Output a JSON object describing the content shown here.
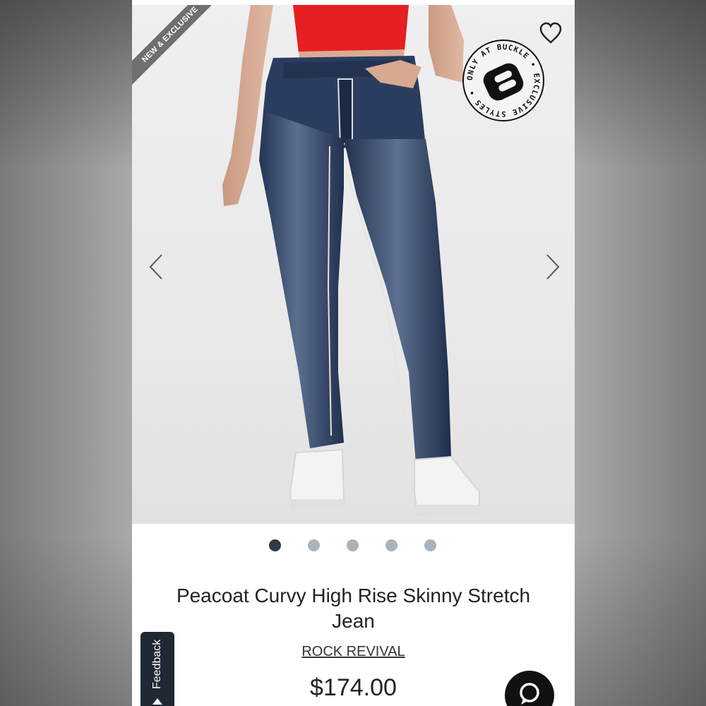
{
  "product": {
    "ribbon": "NEW & EXCLUSIVE",
    "badge_text": "ONLY AT BUCKLE • EXCLUSIVE STYLES •",
    "title": "Peacoat Curvy High Rise Skinny Stretch Jean",
    "brand": "ROCK REVIVAL",
    "price": "$174.00"
  },
  "carousel": {
    "total_images": 5,
    "active_index": 0
  },
  "feedback": {
    "label": "Feedback"
  },
  "icons": {
    "favorite": "heart-outline-icon",
    "prev": "chevron-left-icon",
    "next": "chevron-right-icon",
    "chat": "chat-bubble-icon"
  },
  "colors": {
    "active_dot": "#2f3a44",
    "inactive_dot": "#a9b3bb",
    "feedback_bg": "#1f2833",
    "denim": "#2b3d5e",
    "top": "#e51f22"
  }
}
